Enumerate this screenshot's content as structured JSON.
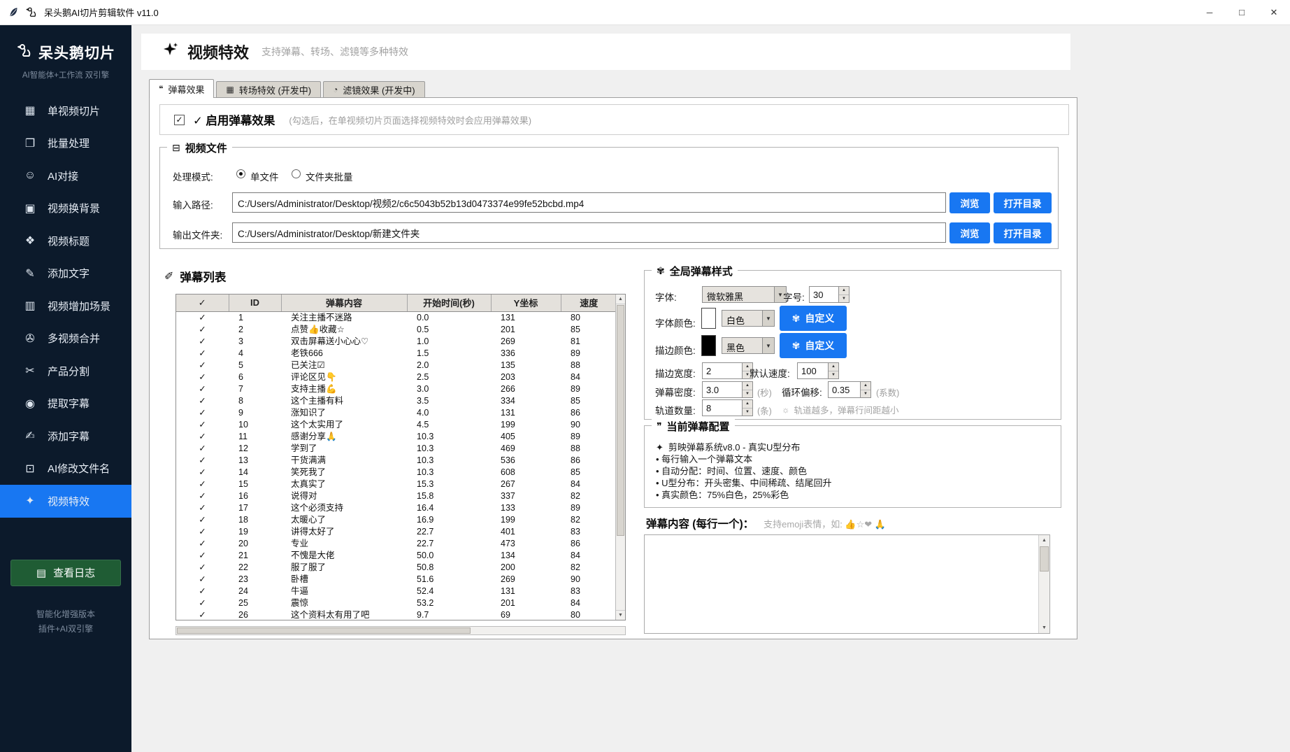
{
  "window": {
    "title": "呆头鹅AI切片剪辑软件 v11.0"
  },
  "sidebar": {
    "logo_text": "呆头鹅切片",
    "tagline": "AI智能体+工作流 双引擎",
    "items": [
      {
        "icon": "clapper-icon",
        "label": "单视频切片"
      },
      {
        "icon": "document-icon",
        "label": "批量处理"
      },
      {
        "icon": "robot-icon",
        "label": "AI对接"
      },
      {
        "icon": "image-icon",
        "label": "视频换背景"
      },
      {
        "icon": "puzzle-icon",
        "label": "视频标题"
      },
      {
        "icon": "pen-icon",
        "label": "添加文字"
      },
      {
        "icon": "film-icon",
        "label": "视频增加场景"
      },
      {
        "icon": "paperclip-icon",
        "label": "多视频合并"
      },
      {
        "icon": "scissors-icon",
        "label": "产品分割"
      },
      {
        "icon": "bulb-icon",
        "label": "提取字幕"
      },
      {
        "icon": "subtitle-icon",
        "label": "添加字幕"
      },
      {
        "icon": "rename-icon",
        "label": "AI修改文件名"
      },
      {
        "icon": "sparkle-icon",
        "label": "视频特效",
        "active": true
      }
    ],
    "log_button": "查看日志",
    "footer": [
      "智能化增强版本",
      "插件+AI双引擎"
    ]
  },
  "header": {
    "title": "视频特效",
    "subtitle": "支持弹幕、转场、滤镜等多种特效"
  },
  "tabs": [
    {
      "icon": "comment-icon",
      "label": "弹幕效果",
      "active": true
    },
    {
      "icon": "clapper-icon",
      "label": "转场特效 (开发中)"
    },
    {
      "icon": "filter-icon",
      "label": "滤镜效果 (开发中)"
    }
  ],
  "enable": {
    "checked": true,
    "label": "✓ 启用弹幕效果",
    "note": "(勾选后，在单视频切片页面选择视频特效时会应用弹幕效果)"
  },
  "video_file": {
    "title": "视频文件",
    "mode_label": "处理模式:",
    "mode_options": [
      {
        "label": "单文件",
        "selected": true
      },
      {
        "label": "文件夹批量",
        "selected": false
      }
    ],
    "input_label": "输入路径:",
    "input_path": "C:/Users/Administrator/Desktop/视频2/c6c5043b52b13d0473374e99fe52bcbd.mp4",
    "output_label": "输出文件夹:",
    "output_path": "C:/Users/Administrator/Desktop/新建文件夹",
    "browse_button": "浏览",
    "open_dir_button": "打开目录"
  },
  "danmaku_list": {
    "title": "弹幕列表",
    "headers": [
      "✓",
      "ID",
      "弹幕内容",
      "开始时间(秒)",
      "Y坐标",
      "速度"
    ],
    "rows": [
      [
        "✓",
        "1",
        "关注主播不迷路",
        "0.0",
        "131",
        "80"
      ],
      [
        "✓",
        "2",
        "点赞👍收藏☆",
        "0.5",
        "201",
        "85"
      ],
      [
        "✓",
        "3",
        "双击屏幕送小心心♡",
        "1.0",
        "269",
        "81"
      ],
      [
        "✓",
        "4",
        "老铁666",
        "1.5",
        "336",
        "89"
      ],
      [
        "✓",
        "5",
        "已关注☑",
        "2.0",
        "135",
        "88"
      ],
      [
        "✓",
        "6",
        "评论区见👇",
        "2.5",
        "203",
        "84"
      ],
      [
        "✓",
        "7",
        "支持主播💪",
        "3.0",
        "266",
        "89"
      ],
      [
        "✓",
        "8",
        "这个主播有料",
        "3.5",
        "334",
        "85"
      ],
      [
        "✓",
        "9",
        "涨知识了",
        "4.0",
        "131",
        "86"
      ],
      [
        "✓",
        "10",
        "这个太实用了",
        "4.5",
        "199",
        "90"
      ],
      [
        "✓",
        "11",
        "感谢分享🙏",
        "10.3",
        "405",
        "89"
      ],
      [
        "✓",
        "12",
        "学到了",
        "10.3",
        "469",
        "88"
      ],
      [
        "✓",
        "13",
        "干货满满",
        "10.3",
        "536",
        "86"
      ],
      [
        "✓",
        "14",
        "笑死我了",
        "10.3",
        "608",
        "85"
      ],
      [
        "✓",
        "15",
        "太真实了",
        "15.3",
        "267",
        "84"
      ],
      [
        "✓",
        "16",
        "说得对",
        "15.8",
        "337",
        "82"
      ],
      [
        "✓",
        "17",
        "这个必须支持",
        "16.4",
        "133",
        "89"
      ],
      [
        "✓",
        "18",
        "太暖心了",
        "16.9",
        "199",
        "82"
      ],
      [
        "✓",
        "19",
        "讲得太好了",
        "22.7",
        "401",
        "83"
      ],
      [
        "✓",
        "20",
        "专业",
        "22.7",
        "473",
        "86"
      ],
      [
        "✓",
        "21",
        "不愧是大佬",
        "50.0",
        "134",
        "84"
      ],
      [
        "✓",
        "22",
        "服了服了",
        "50.8",
        "200",
        "82"
      ],
      [
        "✓",
        "23",
        "卧槽",
        "51.6",
        "269",
        "90"
      ],
      [
        "✓",
        "24",
        "牛逼",
        "52.4",
        "131",
        "83"
      ],
      [
        "✓",
        "25",
        "震惊",
        "53.2",
        "201",
        "84"
      ],
      [
        "✓",
        "26",
        "这个资料太有用了吧",
        "9.7",
        "69",
        "80"
      ]
    ]
  },
  "style_panel": {
    "title": "全局弹幕样式",
    "font_label": "字体:",
    "font_value": "微软雅黑",
    "size_label": "字号:",
    "size_value": "30",
    "font_color_label": "字体颜色:",
    "font_color_value": "白色",
    "font_color_hex": "#ffffff",
    "stroke_color_label": "描边颜色:",
    "stroke_color_value": "黑色",
    "stroke_color_hex": "#000000",
    "custom_button": "自定义",
    "stroke_width_label": "描边宽度:",
    "stroke_width_value": "2",
    "speed_label": "默认速度:",
    "speed_value": "100",
    "density_label": "弹幕密度:",
    "density_value": "3.0",
    "density_unit": "(秒)",
    "offset_label": "循环偏移:",
    "offset_value": "0.35",
    "offset_unit": "(系数)",
    "tracks_label": "轨道数量:",
    "tracks_value": "8",
    "tracks_unit": "(条)",
    "tracks_tip": "轨道越多，弹幕行间距越小"
  },
  "config_panel": {
    "title": "当前弹幕配置",
    "headline": "剪映弹幕系统v8.0 - 真实U型分布",
    "bullets": [
      "每行输入一个弹幕文本",
      "自动分配：时间、位置、速度、颜色",
      "U型分布：开头密集、中间稀疏、结尾回升",
      "真实颜色：75%白色，25%彩色"
    ]
  },
  "danmaku_input": {
    "label": "弹幕内容 (每行一个)：",
    "hint": "支持emoji表情，如: 👍☆❤  🙏",
    "value": ""
  },
  "colors": {
    "accent_blue": "#1877f2",
    "sidebar_bg": "#0c1a2b",
    "log_green": "#1f5c34"
  }
}
